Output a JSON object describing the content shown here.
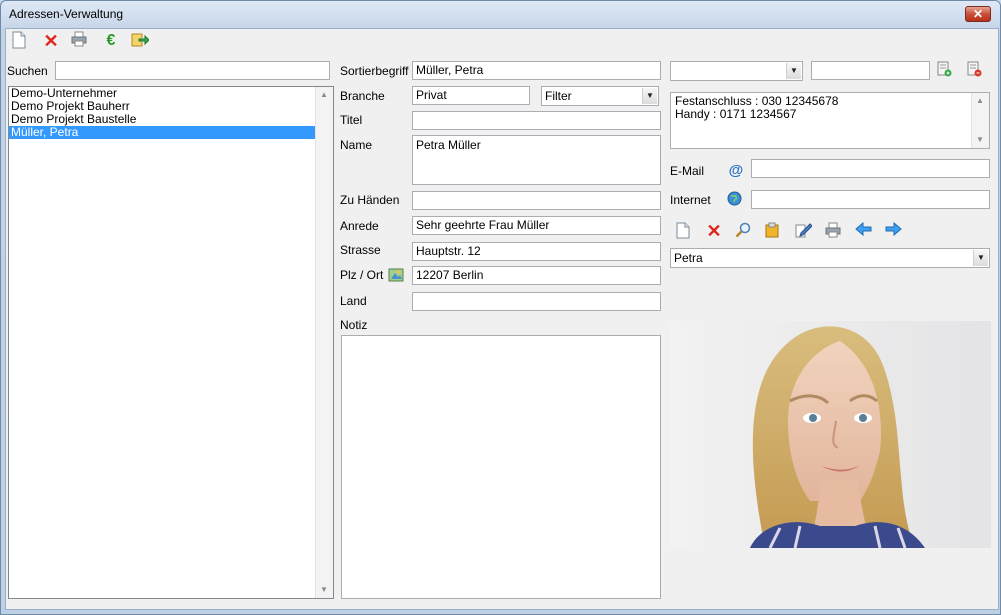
{
  "window": {
    "title": "Adressen-Verwaltung",
    "close_label": "✕"
  },
  "toolbar": {
    "icons": [
      "new-document-icon",
      "delete-icon",
      "print-icon",
      "euro-icon",
      "export-icon"
    ]
  },
  "search": {
    "label": "Suchen",
    "value": ""
  },
  "address_list": {
    "items": [
      "Demo-Unternehmer",
      "Demo Projekt Bauherr",
      "Demo Projekt Baustelle",
      "Müller, Petra"
    ],
    "selected_index": 3
  },
  "form": {
    "sortierbegriff_label": "Sortierbegriff",
    "sortierbegriff_value": "Müller, Petra",
    "branche_label": "Branche",
    "branche_value": "Privat",
    "filter_value": "Filter",
    "titel_label": "Titel",
    "titel_value": "",
    "name_label": "Name",
    "name_value": "Petra Müller",
    "zu_haenden_label": "Zu Händen",
    "zu_haenden_value": "",
    "anrede_label": "Anrede",
    "anrede_value": "Sehr geehrte Frau Müller",
    "strasse_label": "Strasse",
    "strasse_value": "Hauptstr. 12",
    "plz_ort_label": "Plz / Ort",
    "plz_ort_value": "12207 Berlin",
    "land_label": "Land",
    "land_value": "",
    "notiz_label": "Notiz",
    "notiz_value": ""
  },
  "phone": {
    "type_value": "",
    "number_value": "",
    "lines": [
      "Festanschluss : 030 12345678",
      "Handy : 0171 1234567"
    ]
  },
  "contact": {
    "email_label": "E-Mail",
    "email_value": "",
    "internet_label": "Internet",
    "internet_value": ""
  },
  "person": {
    "selected_value": "Petra"
  },
  "colors": {
    "selection": "#3399ff",
    "titlebar": "#c4d4e8",
    "close": "#c9503b"
  }
}
